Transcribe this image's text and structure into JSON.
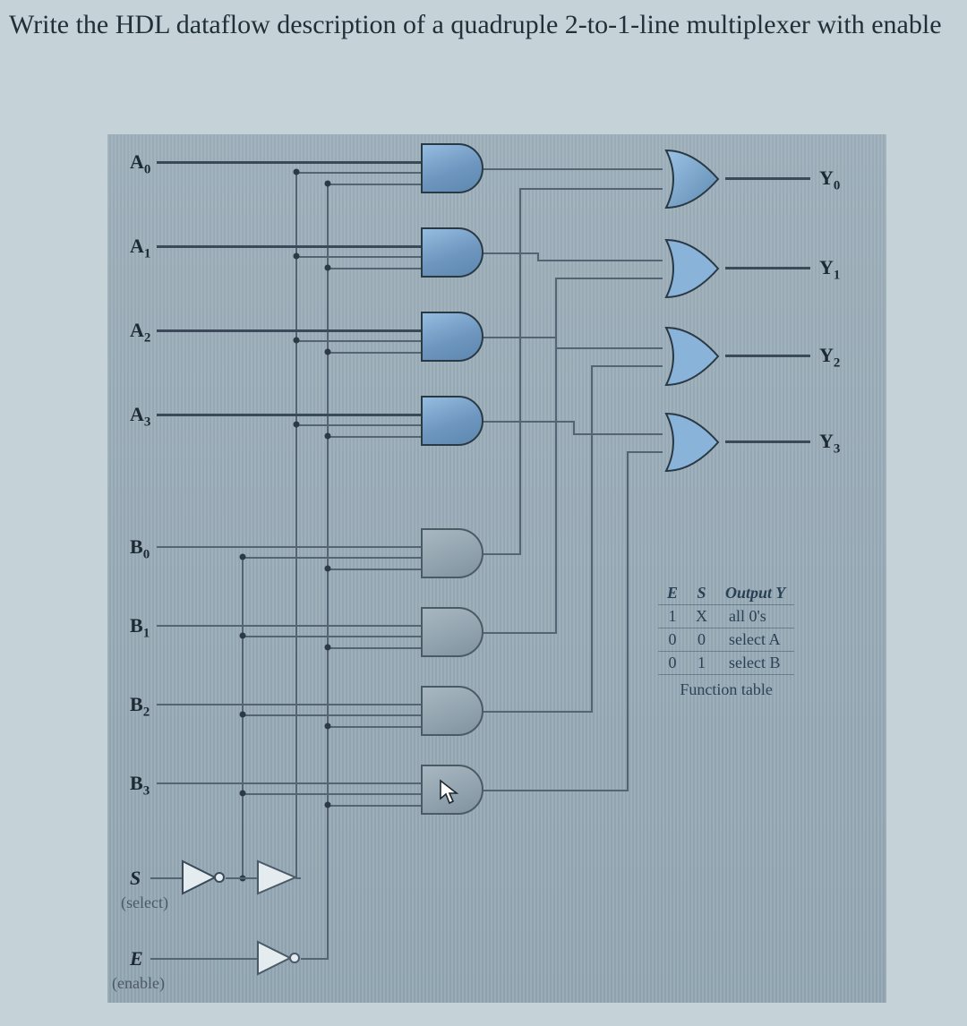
{
  "question_text": "Write the HDL dataflow description of a quadruple 2-to-1-line multiplexer with enable",
  "inputs": {
    "A": [
      "A",
      "A",
      "A",
      "A"
    ],
    "A_sub": [
      "0",
      "1",
      "2",
      "3"
    ],
    "B": [
      "B",
      "B",
      "B",
      "B"
    ],
    "B_sub": [
      "0",
      "1",
      "2",
      "3"
    ],
    "S": "S",
    "S_label": "(select)",
    "E": "E",
    "E_label": "(enable)"
  },
  "outputs": {
    "Y": [
      "Y",
      "Y",
      "Y",
      "Y"
    ],
    "Y_sub": [
      "0",
      "1",
      "2",
      "3"
    ]
  },
  "function_table": {
    "headers": [
      "E",
      "S",
      "Output Y"
    ],
    "rows": [
      [
        "1",
        "X",
        "all 0's"
      ],
      [
        "0",
        "0",
        "select A"
      ],
      [
        "0",
        "1",
        "select B"
      ]
    ],
    "caption": "Function table"
  },
  "icons": {
    "cursor": "pointer-cursor"
  },
  "chart_data": {
    "type": "diagram",
    "title": "Quadruple 2-to-1-line multiplexer with enable — gate-level schematic",
    "inputs": [
      "A0",
      "A1",
      "A2",
      "A3",
      "B0",
      "B1",
      "B2",
      "B3",
      "S (select)",
      "E (enable)"
    ],
    "outputs": [
      "Y0",
      "Y1",
      "Y2",
      "Y3"
    ],
    "gates": [
      {
        "name": "NOT_S",
        "type": "NOT",
        "in": [
          "S"
        ],
        "out": "Sn"
      },
      {
        "name": "NOT_E",
        "type": "NOT",
        "in": [
          "E"
        ],
        "out": "En"
      },
      {
        "name": "AND_A0",
        "type": "AND",
        "in": [
          "A0",
          "Sn",
          "En"
        ],
        "out": "a0"
      },
      {
        "name": "AND_A1",
        "type": "AND",
        "in": [
          "A1",
          "Sn",
          "En"
        ],
        "out": "a1"
      },
      {
        "name": "AND_A2",
        "type": "AND",
        "in": [
          "A2",
          "Sn",
          "En"
        ],
        "out": "a2"
      },
      {
        "name": "AND_A3",
        "type": "AND",
        "in": [
          "A3",
          "Sn",
          "En"
        ],
        "out": "a3"
      },
      {
        "name": "AND_B0",
        "type": "AND",
        "in": [
          "B0",
          "S",
          "En"
        ],
        "out": "b0"
      },
      {
        "name": "AND_B1",
        "type": "AND",
        "in": [
          "B1",
          "S",
          "En"
        ],
        "out": "b1"
      },
      {
        "name": "AND_B2",
        "type": "AND",
        "in": [
          "B2",
          "S",
          "En"
        ],
        "out": "b2"
      },
      {
        "name": "AND_B3",
        "type": "AND",
        "in": [
          "B3",
          "S",
          "En"
        ],
        "out": "b3"
      },
      {
        "name": "OR_Y0",
        "type": "OR",
        "in": [
          "a0",
          "b0"
        ],
        "out": "Y0"
      },
      {
        "name": "OR_Y1",
        "type": "OR",
        "in": [
          "a1",
          "b1"
        ],
        "out": "Y1"
      },
      {
        "name": "OR_Y2",
        "type": "OR",
        "in": [
          "a2",
          "b2"
        ],
        "out": "Y2"
      },
      {
        "name": "OR_Y3",
        "type": "OR",
        "in": [
          "a3",
          "b3"
        ],
        "out": "Y3"
      }
    ],
    "function_table": {
      "headers": [
        "E",
        "S",
        "Output Y"
      ],
      "rows": [
        [
          "1",
          "X",
          "all 0's"
        ],
        [
          "0",
          "0",
          "select A"
        ],
        [
          "0",
          "1",
          "select B"
        ]
      ]
    }
  }
}
